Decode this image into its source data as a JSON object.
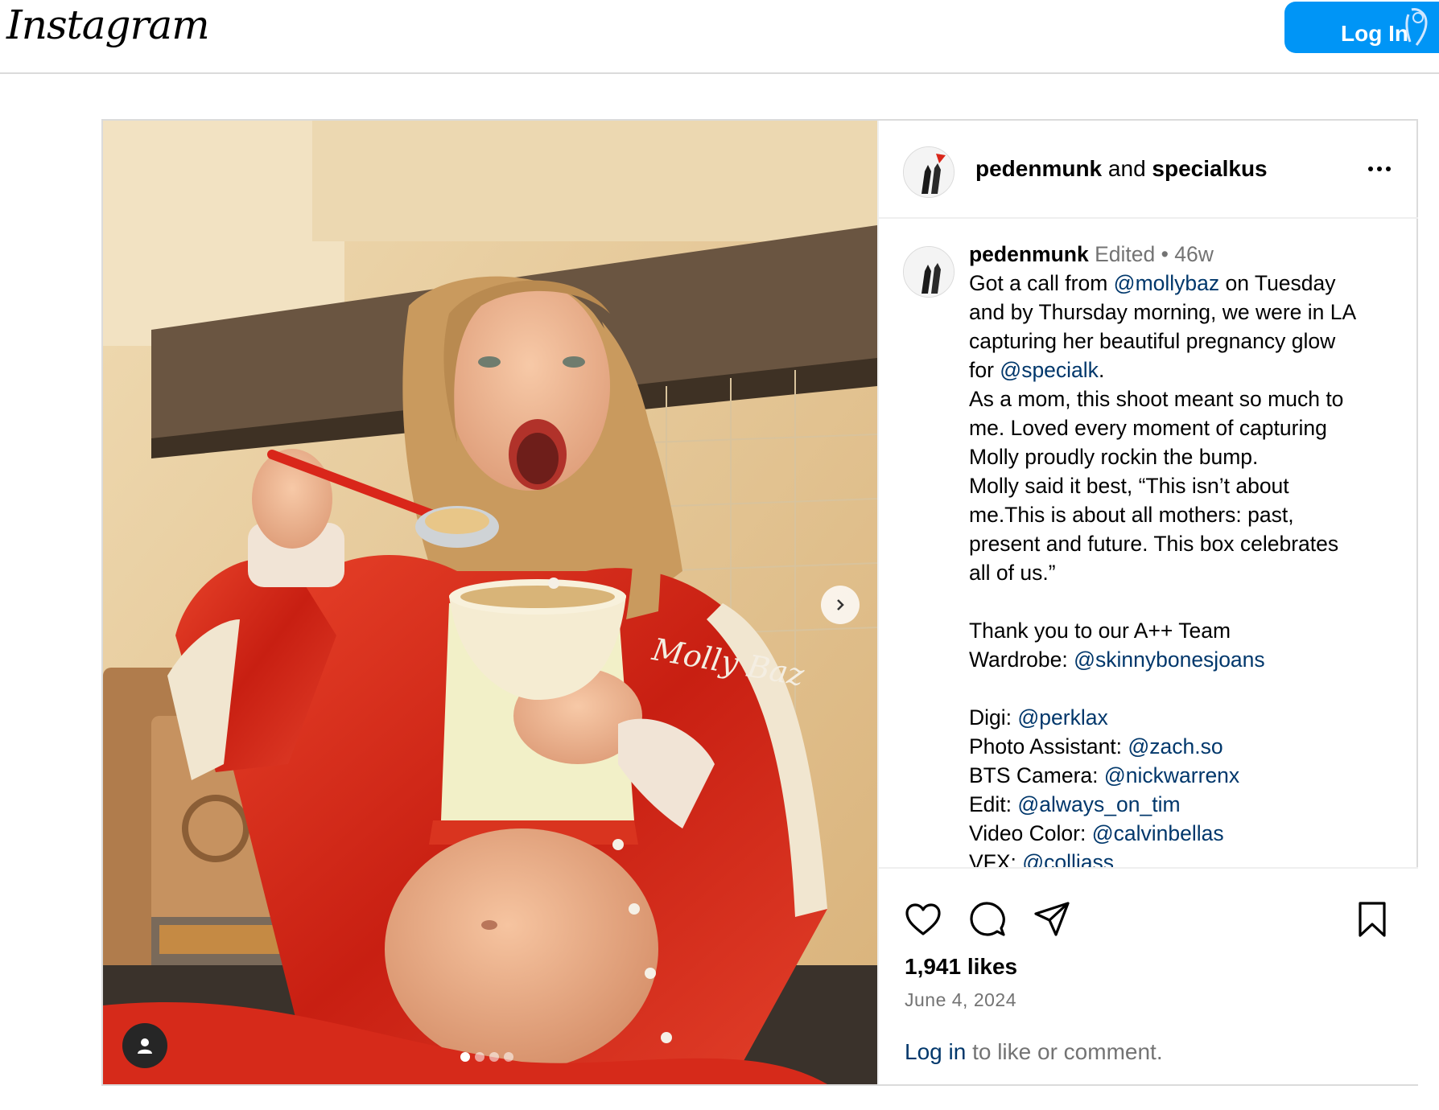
{
  "app": {
    "logo_text": "Instagram"
  },
  "header": {
    "login_label": "Log In",
    "signup_peek": "S"
  },
  "post": {
    "authors": {
      "primary": "pedenmunk",
      "connector": "and",
      "secondary": "specialkus"
    },
    "more_icon": "more-horizontal-icon",
    "carousel": {
      "slide_count": 4,
      "active_index": 0
    },
    "caption": {
      "user": "pedenmunk",
      "edited": "Edited",
      "separator": "•",
      "age": "46w",
      "l1_a": "Got a call from ",
      "l1_m": "@mollybaz",
      "l1_b": " on Tuesday",
      "l2": "and by Thursday morning, we were in LA",
      "l3": "capturing her beautiful pregnancy glow",
      "l4_a": "for ",
      "l4_m": "@specialk",
      "l4_b": ".",
      "l5": "As a mom, this shoot meant so much to",
      "l6": "me. Loved every moment of capturing",
      "l7": "Molly proudly rockin the bump.",
      "l8": "Molly said it best, “This isn’t about",
      "l9": "me.This is about all mothers: past,",
      "l10": "present and future. This box celebrates",
      "l11": "all of us.”",
      "l12": "Thank you to our A++ Team",
      "l13_a": "Wardrobe: ",
      "l13_m": "@skinnybonesjoans",
      "l14_a": "Digi: ",
      "l14_m": "@perklax",
      "l15_a": "Photo Assistant: ",
      "l15_m": "@zach.so",
      "l16_a": "BTS Camera: ",
      "l16_m": "@nickwarrenx",
      "l17_a": "Edit: ",
      "l17_m": "@always_on_tim",
      "l18_a": "Video Color: ",
      "l18_m": "@calvinbellas",
      "l19_a": "VFX: ",
      "l19_m": "@colliass"
    },
    "likes": "1,941 likes",
    "date": "June 4, 2024",
    "login_prompt": {
      "link": "Log in",
      "rest": " to like or comment."
    },
    "photo": {
      "jacket_text": "Molly Baz"
    },
    "colors": {
      "link_blue": "#00376b",
      "button_blue": "#0095f6",
      "jacket_red": "#d42a1c"
    }
  }
}
